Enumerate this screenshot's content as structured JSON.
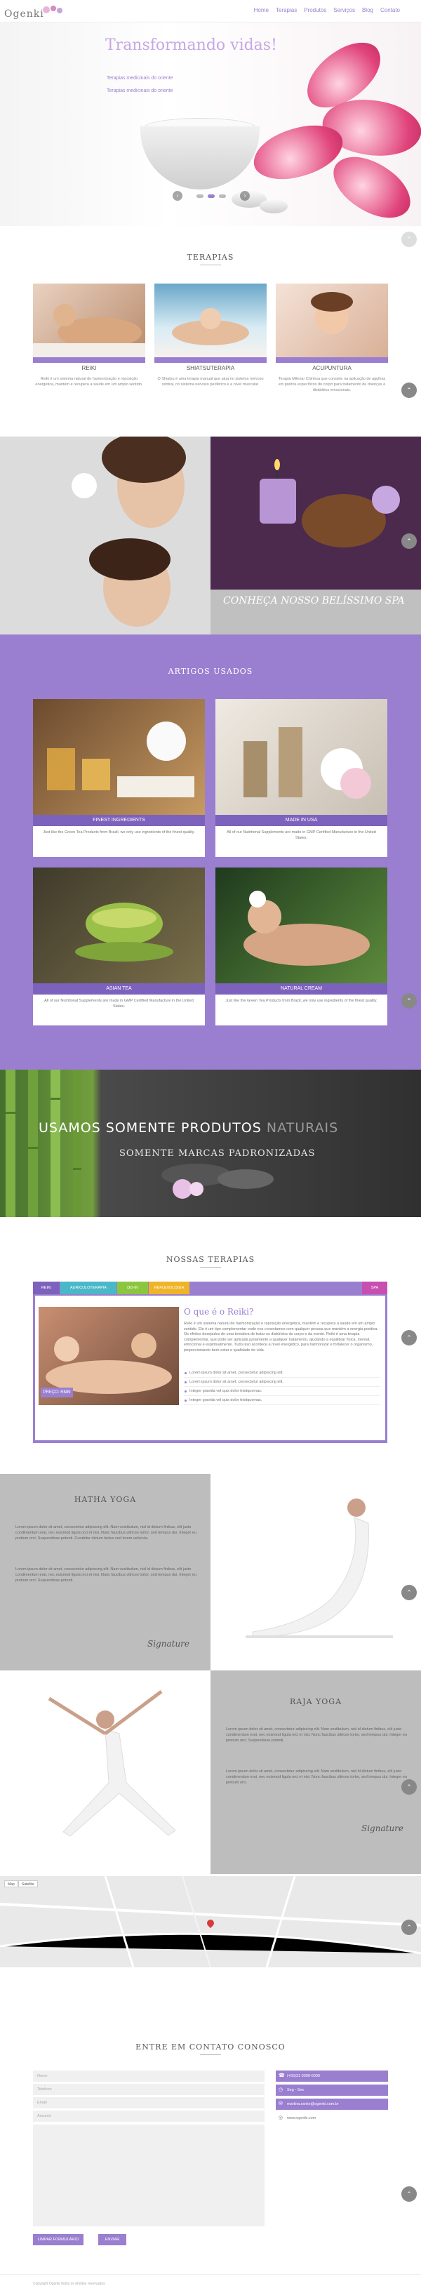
{
  "header": {
    "logo_text": "Ogenki",
    "nav": [
      "Home",
      "Terapias",
      "Produtos",
      "Serviços",
      "Blog",
      "Contato"
    ]
  },
  "hero": {
    "title": "Transformando vidas!",
    "subtitle1": "Terapias medicinais do oriente",
    "subtitle2": "Terapias medicinais do oriente"
  },
  "terapias": {
    "title": "TERAPIAS",
    "cards": [
      {
        "name": "REIKI",
        "text": "Reiki é um sistema natural de harmonização e reposição energética, mantém e recupera a saúde em um amplo sentido."
      },
      {
        "name": "SHIATSUTERAPIA",
        "text": "O Shiatsu é uma terapia manual que atua no sistema nervoso central, no sistema nervoso periférico e a nível muscular."
      },
      {
        "name": "ACUPUNTURA",
        "text": "Terapia Milenar Chinesa que consiste na aplicação de agulhas em pontos específicos do corpo para tratamento de doenças e distúrbios emocionais."
      }
    ]
  },
  "spa": {
    "caption": "CONHEÇA NOSSO BELÍSSIMO SPA"
  },
  "artigos": {
    "title": "ARTIGOS USADOS",
    "items": [
      {
        "label": "FINEST INGREDIENTS",
        "text": "Just like the Green Tea Products from Brazil, we only use ingredients of the finest quality."
      },
      {
        "label": "MADE IN USA",
        "text": "All of our Nutritional Supplements are made in GMP Certified Manufacture in the United States."
      },
      {
        "label": "ASIAN TEA",
        "text": "All of our Nutritional Supplements are made in GMP Certified Manufacture in the United States."
      },
      {
        "label": "NATURAL CREAM",
        "text": "Just like the Green Tea Products from Brazil, we only use ingredients of the finest quality."
      }
    ]
  },
  "naturais": {
    "line1_a": "USAMOS SOMENTE PRODUTOS ",
    "line1_b": "NATURAIS",
    "line2": "SOMENTE MARCAS PADRONIZADAS"
  },
  "nossas_terapias": {
    "title": "NOSSAS TERAPIAS",
    "tabs": [
      "REIKI",
      "AURICULOTERAPIA",
      "DO-IN",
      "REFLEXOLOGIA",
      "SPA"
    ],
    "heading": "O que é o Reiki?",
    "paragraph": "Reiki é um sistema natural de harmonização e reposição energética, mantém e recupera a saúde em um amplo sentido. Ele é um tipo complementar onde nos conectamos com qualquer pessoa que mantém a energia positiva. Os efeitos desejados de uma tentativa de tratar os distúrbios do corpo e da mente. Reiki é uma terapia complementar, que pode ser aplicada juntamente a qualquer tratamento, ajudando a equilibrar física, mental, emocional e espiritualmente. Tudo isso acontece a nível energético, para harmonizar e fortalecer o organismo, proporcionando bem-estar e qualidade de vida.",
    "price": "PREÇO: R$89",
    "list": [
      "Lorem ipsum dolor sit amet, consectetur adipiscing elit.",
      "Lorem ipsum dolor sit amet, consectetur adipiscing elit.",
      "Integer gravida vel quis dolor tristiquemas.",
      "Integer gravida vel quis dolor tristiquemas."
    ]
  },
  "hatha": {
    "title": "HATHA YOGA",
    "p1": "Lorem ipsum dolor sit amet, consectetur adipiscing elit. Nam vestibulum, nisl id dictum finibus, elit justo condimentum erat, nec euismod ligula orci et nisi. Nunc faucibus ultrices tortor, sed tempus dui. Integer eu pretium orci. Suspendisse potenti. Curabitur dictum lectus sed lorem vehicula.",
    "p2": "Lorem ipsum dolor sit amet, consectetur adipiscing elit. Nam vestibulum, nisl id dictum finibus, elit justo condimentum erat, nec euismod ligula orci et nisi. Nunc faucibus ultrices tortor, sed tempus dui. Integer eu pretium orci. Suspendisse potenti.",
    "signature": "Signature"
  },
  "raja": {
    "title": "RAJA YOGA",
    "p1": "Lorem ipsum dolor sit amet, consectetur adipiscing elit. Nam vestibulum, nisl id dictum finibus, elit justo condimentum erat, nec euismod ligula orci et nisi. Nunc faucibus ultrices tortor, sed tempus dui. Integer eu pretium orci. Suspendisse potenti.",
    "p2": "Lorem ipsum dolor sit amet, consectetur adipiscing elit. Nam vestibulum, nisl id dictum finibus, elit justo condimentum erat, nec euismod ligula orci et nisi. Nunc faucibus ultrices tortor, sed tempus dui. Integer eu pretium orci.",
    "signature": "Signature"
  },
  "map": {
    "map_btn": "Map",
    "sat_btn": "Satellite"
  },
  "contato": {
    "title": "ENTRE EM CONTATO CONOSCO",
    "fields": [
      "Nome",
      "Telefone",
      "Email",
      "Assunto"
    ],
    "clear_btn": "LIMPAR FORMULÁRIO",
    "send_btn": "ENVIAR",
    "info": [
      "(+55)21 0000-0000",
      "Seg - Sex",
      "martina.ranke@ogenki.com.br",
      "www.ogenki.com"
    ]
  },
  "footer": {
    "text": "Copyright Ogenki todos os direitos reservados"
  },
  "colors": {
    "accent": "#9a7fd0",
    "accent_dark": "#7d62bd"
  }
}
